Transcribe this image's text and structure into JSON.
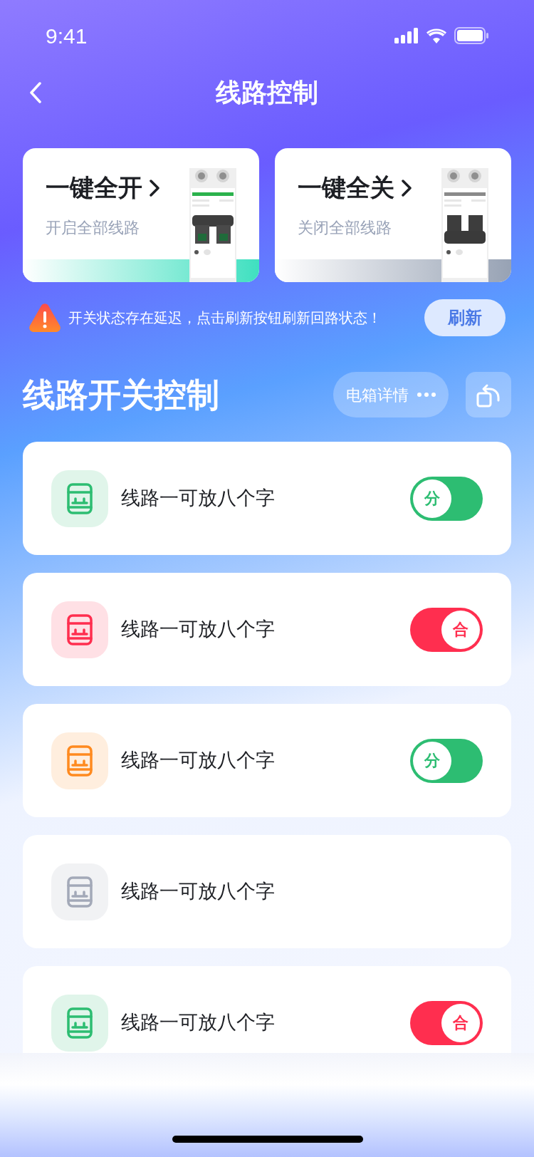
{
  "status_bar": {
    "time": "9:41"
  },
  "header": {
    "title": "线路控制"
  },
  "quick_actions": [
    {
      "kind": "on",
      "title": "一键全开",
      "subtitle": "开启全部线路"
    },
    {
      "kind": "off",
      "title": "一键全关",
      "subtitle": "关闭全部线路"
    }
  ],
  "notice": {
    "text": "开关状态存在延迟，点击刷新按钮刷新回路状态！",
    "button": "刷新"
  },
  "section": {
    "title": "线路开关控制",
    "details_button": "电箱详情"
  },
  "circuits": [
    {
      "name": "线路一可放八个字",
      "color": "#2dbd72",
      "switch": {
        "text": "分",
        "on": false
      }
    },
    {
      "name": "线路一可放八个字",
      "color": "#ff2e4f",
      "switch": {
        "text": "合",
        "on": true
      }
    },
    {
      "name": "线路一可放八个字",
      "color": "#ff8a1f",
      "switch": {
        "text": "分",
        "on": false
      }
    },
    {
      "name": "线路一可放八个字",
      "color": "#a3a9b8"
    },
    {
      "name": "线路一可放八个字",
      "color": "#2dbd72",
      "switch": {
        "text": "合",
        "on": true
      }
    }
  ]
}
